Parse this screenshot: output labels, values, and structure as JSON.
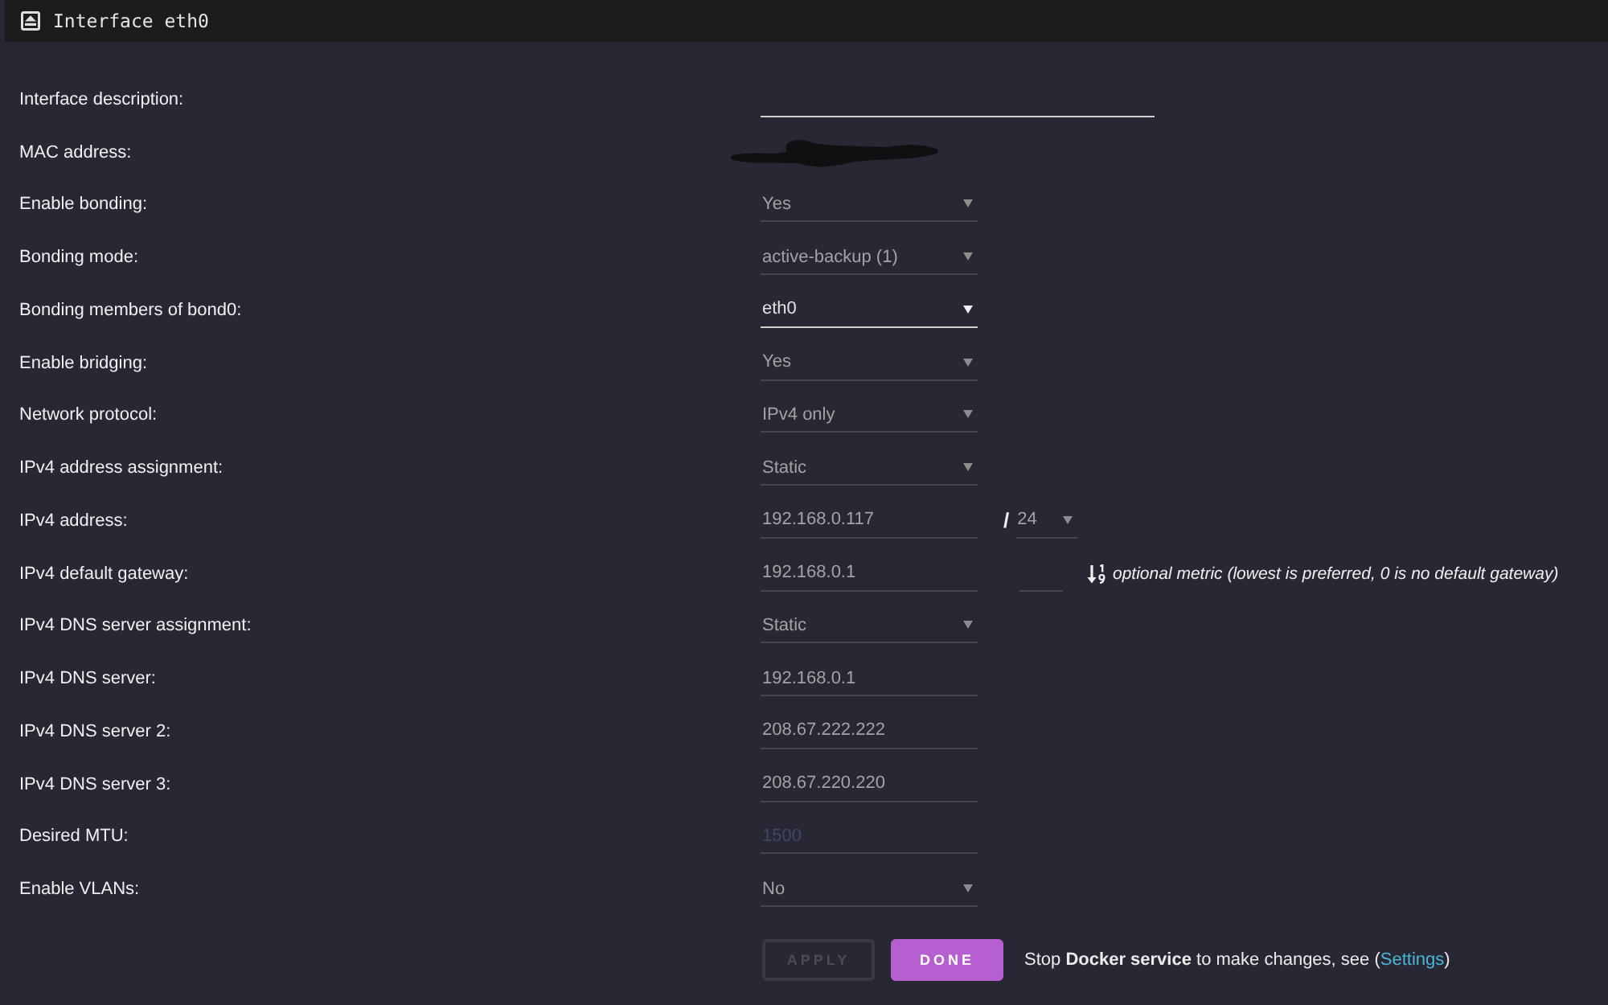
{
  "window": {
    "title": "Interface eth0"
  },
  "fields": [
    {
      "label": "Interface description:",
      "kind": "text",
      "wide": true,
      "focused": true
    },
    {
      "label": "MAC address:",
      "kind": "redacted"
    },
    {
      "label": "Enable bonding:",
      "kind": "select",
      "value": "Yes",
      "focused": false
    },
    {
      "label": "Bonding mode:",
      "kind": "select",
      "value": "active-backup (1)",
      "focused": false
    },
    {
      "label": "Bonding members of bond0:",
      "kind": "select",
      "value": "eth0",
      "focused": true
    },
    {
      "label": "Enable bridging:",
      "kind": "select",
      "value": "Yes",
      "focused": false
    },
    {
      "label": "Network protocol:",
      "kind": "select",
      "value": "IPv4 only",
      "focused": false
    },
    {
      "label": "IPv4 address assignment:",
      "kind": "select",
      "value": "Static",
      "focused": false
    },
    {
      "label": "IPv4 address:",
      "kind": "address",
      "value": "192.168.0.117",
      "separator": "/",
      "prefix": "24",
      "focused": false
    },
    {
      "label": "IPv4 default gateway:",
      "kind": "gateway",
      "value": "192.168.0.1",
      "hint": "optional metric (lowest is preferred, 0 is no default gateway)",
      "focused": false
    },
    {
      "label": "IPv4 DNS server assignment:",
      "kind": "select",
      "value": "Static",
      "focused": false
    },
    {
      "label": "IPv4 DNS server:",
      "kind": "text",
      "value": "192.168.0.1",
      "focused": false
    },
    {
      "label": "IPv4 DNS server 2:",
      "kind": "text",
      "value": "208.67.222.222",
      "focused": false
    },
    {
      "label": "IPv4 DNS server 3:",
      "kind": "text",
      "value": "208.67.220.220",
      "focused": false
    },
    {
      "label": "Desired MTU:",
      "kind": "text",
      "placeholder": "1500",
      "focused": false
    },
    {
      "label": "Enable VLANs:",
      "kind": "select",
      "value": "No",
      "focused": false
    }
  ],
  "buttons": [
    {
      "label": "APPLY",
      "disabled": true
    },
    {
      "label": "DONE",
      "disabled": false
    }
  ],
  "notice": {
    "text": "Stop **Docker service** to make changes, see (",
    "link": "Settings",
    "suffix": ")"
  }
}
